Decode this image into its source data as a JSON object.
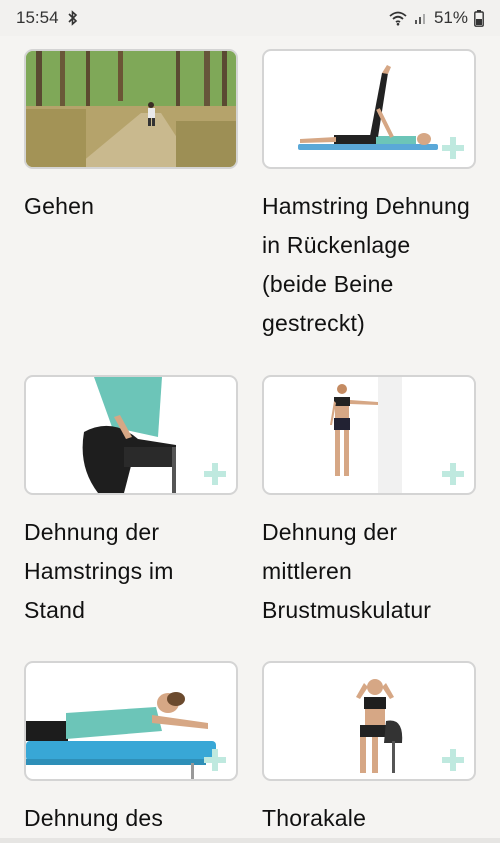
{
  "status_bar": {
    "time": "15:54",
    "battery": "51%",
    "icons": [
      "bluetooth-icon",
      "wifi-icon",
      "signal-icon",
      "battery-icon"
    ]
  },
  "exercises": [
    {
      "title": "Gehen",
      "image": "walking-forest-photo"
    },
    {
      "title": "Hamstring Dehnung in Rückenlage (beide Beine gestreckt)",
      "image": "supine-hamstring-stretch-illustration"
    },
    {
      "title": "Dehnung der Hamstrings im Stand",
      "image": "standing-hamstring-stretch-illustration"
    },
    {
      "title": "Dehnung der mittleren Brustmuskulatur",
      "image": "chest-stretch-wall-illustration"
    },
    {
      "title": "Dehnung des",
      "image": "lying-bench-stretch-illustration"
    },
    {
      "title": "Thorakale",
      "image": "seated-thoracic-extension-illustration"
    }
  ],
  "colors": {
    "background": "#f5f4f2",
    "plus_accent": "#bfe9df",
    "card_border": "#d4d4d4"
  }
}
